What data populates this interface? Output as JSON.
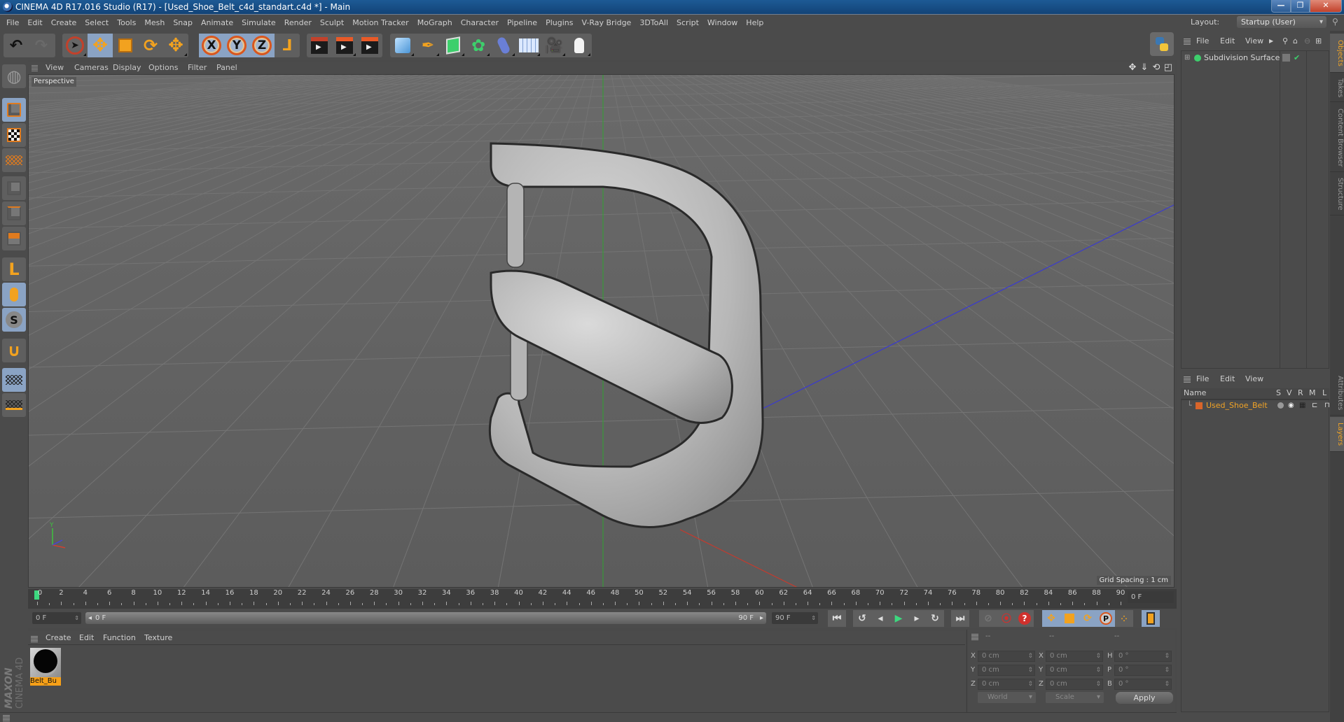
{
  "window": {
    "title": "CINEMA 4D R17.016 Studio (R17) - [Used_Shoe_Belt_c4d_standart.c4d *] - Main",
    "controls": {
      "minimize": "—",
      "maximize": "❐",
      "close": "✕"
    }
  },
  "menu": {
    "items": [
      "File",
      "Edit",
      "Create",
      "Select",
      "Tools",
      "Mesh",
      "Snap",
      "Animate",
      "Simulate",
      "Render",
      "Sculpt",
      "Motion Tracker",
      "MoGraph",
      "Character",
      "Pipeline",
      "Plugins",
      "V-Ray Bridge",
      "3DToAll",
      "Script",
      "Window",
      "Help"
    ],
    "layout_label": "Layout:",
    "layout_value": "Startup (User)"
  },
  "toolbar": {
    "undo": "undo-icon",
    "redo": "redo-icon",
    "tools": [
      "live-selection",
      "move",
      "scale",
      "rotate",
      "recent-tool"
    ],
    "axes": [
      "X",
      "Y",
      "Z"
    ],
    "coordinate_system": "world-coordinates-icon",
    "render": [
      "render-view",
      "render-picture-viewer",
      "render-settings"
    ],
    "create": [
      "cube",
      "pen",
      "subdivision-surface",
      "cloner",
      "deformer",
      "floor",
      "camera",
      "light"
    ]
  },
  "left_tools": [
    "make-editable",
    "model-mode",
    "texture-mode",
    "workplane-mode",
    "points-mode",
    "edges-mode",
    "polygons-mode",
    "axis-mode",
    "tweak-mode",
    "solo-mode",
    "snapping",
    "locked-workplane",
    "planar-workplane"
  ],
  "viewport": {
    "menu": [
      "View",
      "Cameras",
      "Display",
      "Options",
      "Filter",
      "Panel"
    ],
    "label": "Perspective",
    "grid_spacing": "Grid Spacing : 1 cm",
    "axis_colors": {
      "x": "#c53a2d",
      "y": "#2da82d",
      "z": "#3a3ad0"
    }
  },
  "timeline": {
    "ticks": [
      0,
      2,
      4,
      6,
      8,
      10,
      12,
      14,
      16,
      18,
      20,
      22,
      24,
      26,
      28,
      30,
      32,
      34,
      36,
      38,
      40,
      42,
      44,
      46,
      48,
      50,
      52,
      54,
      56,
      58,
      60,
      62,
      64,
      66,
      68,
      70,
      72,
      74,
      76,
      78,
      80,
      82,
      84,
      86,
      88,
      90
    ],
    "current_frame": "0 F",
    "start_field": "0 F",
    "range_start": "0 F",
    "range_end": "90 F",
    "end_field": "90 F"
  },
  "transport": {
    "buttons": [
      "go-to-start",
      "previous-key",
      "previous-frame",
      "play",
      "next-frame",
      "next-key",
      "go-to-end"
    ],
    "record": [
      "motion-record",
      "record-active",
      "autokey-help"
    ],
    "keys": [
      "key-position",
      "key-scale",
      "key-rotation",
      "key-parameter",
      "key-pla"
    ],
    "timeline_window": "timeline-icon"
  },
  "material_manager": {
    "menu": [
      "Create",
      "Edit",
      "Function",
      "Texture"
    ],
    "materials": [
      {
        "name": "Belt_Bu",
        "color": "#f6a018"
      }
    ]
  },
  "brand": {
    "maxon": "MAXON",
    "product": "CINEMA 4D"
  },
  "coordinates": {
    "headers": [
      "--",
      "--",
      "--"
    ],
    "rows": [
      {
        "pos_label": "X",
        "pos": "0 cm",
        "size_label": "X",
        "size": "0 cm",
        "rot_label": "H",
        "rot": "0 °"
      },
      {
        "pos_label": "Y",
        "pos": "0 cm",
        "size_label": "Y",
        "size": "0 cm",
        "rot_label": "P",
        "rot": "0 °"
      },
      {
        "pos_label": "Z",
        "pos": "0 cm",
        "size_label": "Z",
        "size": "0 cm",
        "rot_label": "B",
        "rot": "0 °"
      }
    ],
    "space": "World",
    "mode": "Scale",
    "apply": "Apply"
  },
  "object_manager": {
    "menu": [
      "File",
      "Edit",
      "View"
    ],
    "objects": [
      {
        "name": "Subdivision Surface",
        "enabled": true
      }
    ]
  },
  "layer_manager": {
    "menu": [
      "File",
      "Edit",
      "View"
    ],
    "columns": [
      "Name",
      "S",
      "V",
      "R",
      "M",
      "L"
    ],
    "layers": [
      {
        "name": "Used_Shoe_Belt",
        "color": "#d9652a"
      }
    ]
  },
  "side_tabs": {
    "top": [
      "Objects",
      "Takes",
      "Content Browser",
      "Structure"
    ],
    "bottom": [
      "Attributes",
      "Layers"
    ],
    "active": [
      "Objects",
      "Layers"
    ]
  },
  "accent": "#f0a326"
}
